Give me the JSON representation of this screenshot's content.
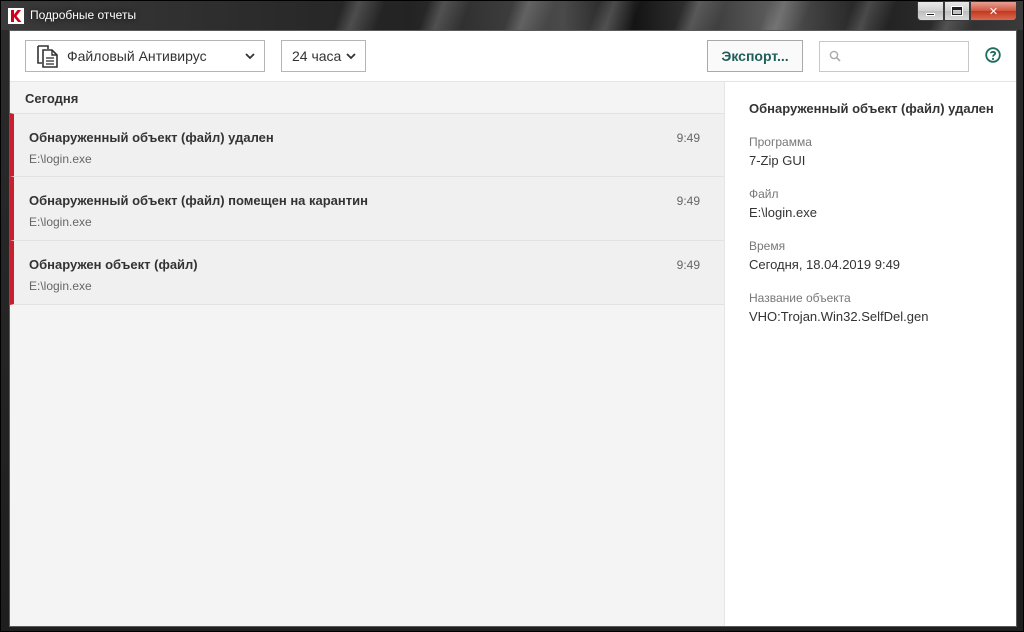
{
  "window": {
    "title": "Подробные отчеты",
    "controls": {
      "minimize": "minimize-icon",
      "maximize": "maximize-icon",
      "close": "close-icon"
    }
  },
  "toolbar": {
    "component_select": {
      "value": "Файловый Антивирус",
      "icon": "document-icon"
    },
    "period_select": {
      "value": "24 часа"
    },
    "export_label": "Экспорт...",
    "search_placeholder": ""
  },
  "list": {
    "group_label": "Сегодня",
    "items": [
      {
        "title": "Обнаруженный объект (файл) удален",
        "path": "E:\\login.exe",
        "time": "9:49"
      },
      {
        "title": "Обнаруженный объект (файл) помещен на карантин",
        "path": "E:\\login.exe",
        "time": "9:49"
      },
      {
        "title": "Обнаружен объект (файл)",
        "path": "E:\\login.exe",
        "time": "9:49"
      }
    ]
  },
  "details": {
    "title": "Обнаруженный объект (файл) удален",
    "fields": [
      {
        "label": "Программа",
        "value": "7-Zip GUI"
      },
      {
        "label": "Файл",
        "value": "E:\\login.exe"
      },
      {
        "label": "Время",
        "value": "Сегодня, 18.04.2019 9:49"
      },
      {
        "label": "Название объекта",
        "value": "VHO:Trojan.Win32.SelfDel.gen"
      }
    ]
  },
  "colors": {
    "accent": "#1f5e5a",
    "severity": "#c8202f"
  }
}
